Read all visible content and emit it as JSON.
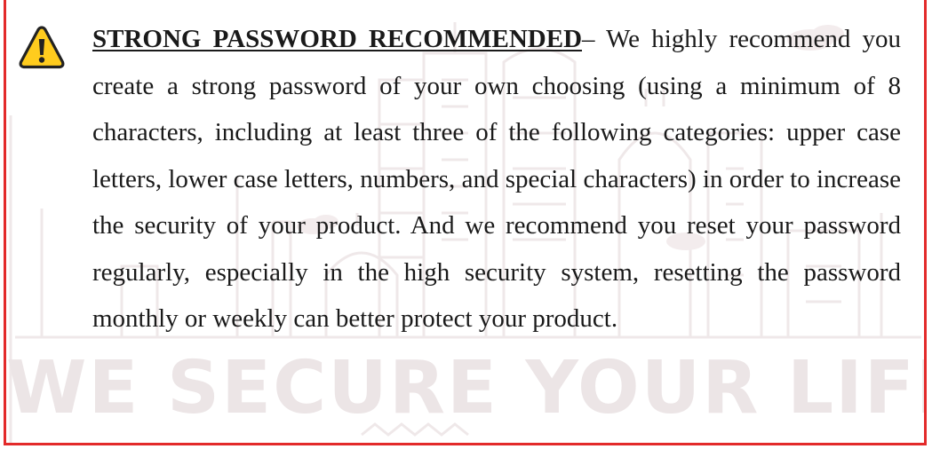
{
  "notice": {
    "icon": "warning-icon",
    "heading": "STRONG PASSWORD RECOMMENDED",
    "body": "– We highly recommend you create a strong password of your own choosing (using a minimum of 8 characters, including at least three of the following categories: upper case letters, lower case letters, numbers, and special characters) in order to increase the security of your product. And we recommend you reset your password regularly, especially in the high security system, resetting the password monthly or weekly can better protect your product.",
    "border_color": "#e32a2a"
  },
  "watermark": {
    "text": "WE SECURE YOUR LIFE"
  }
}
